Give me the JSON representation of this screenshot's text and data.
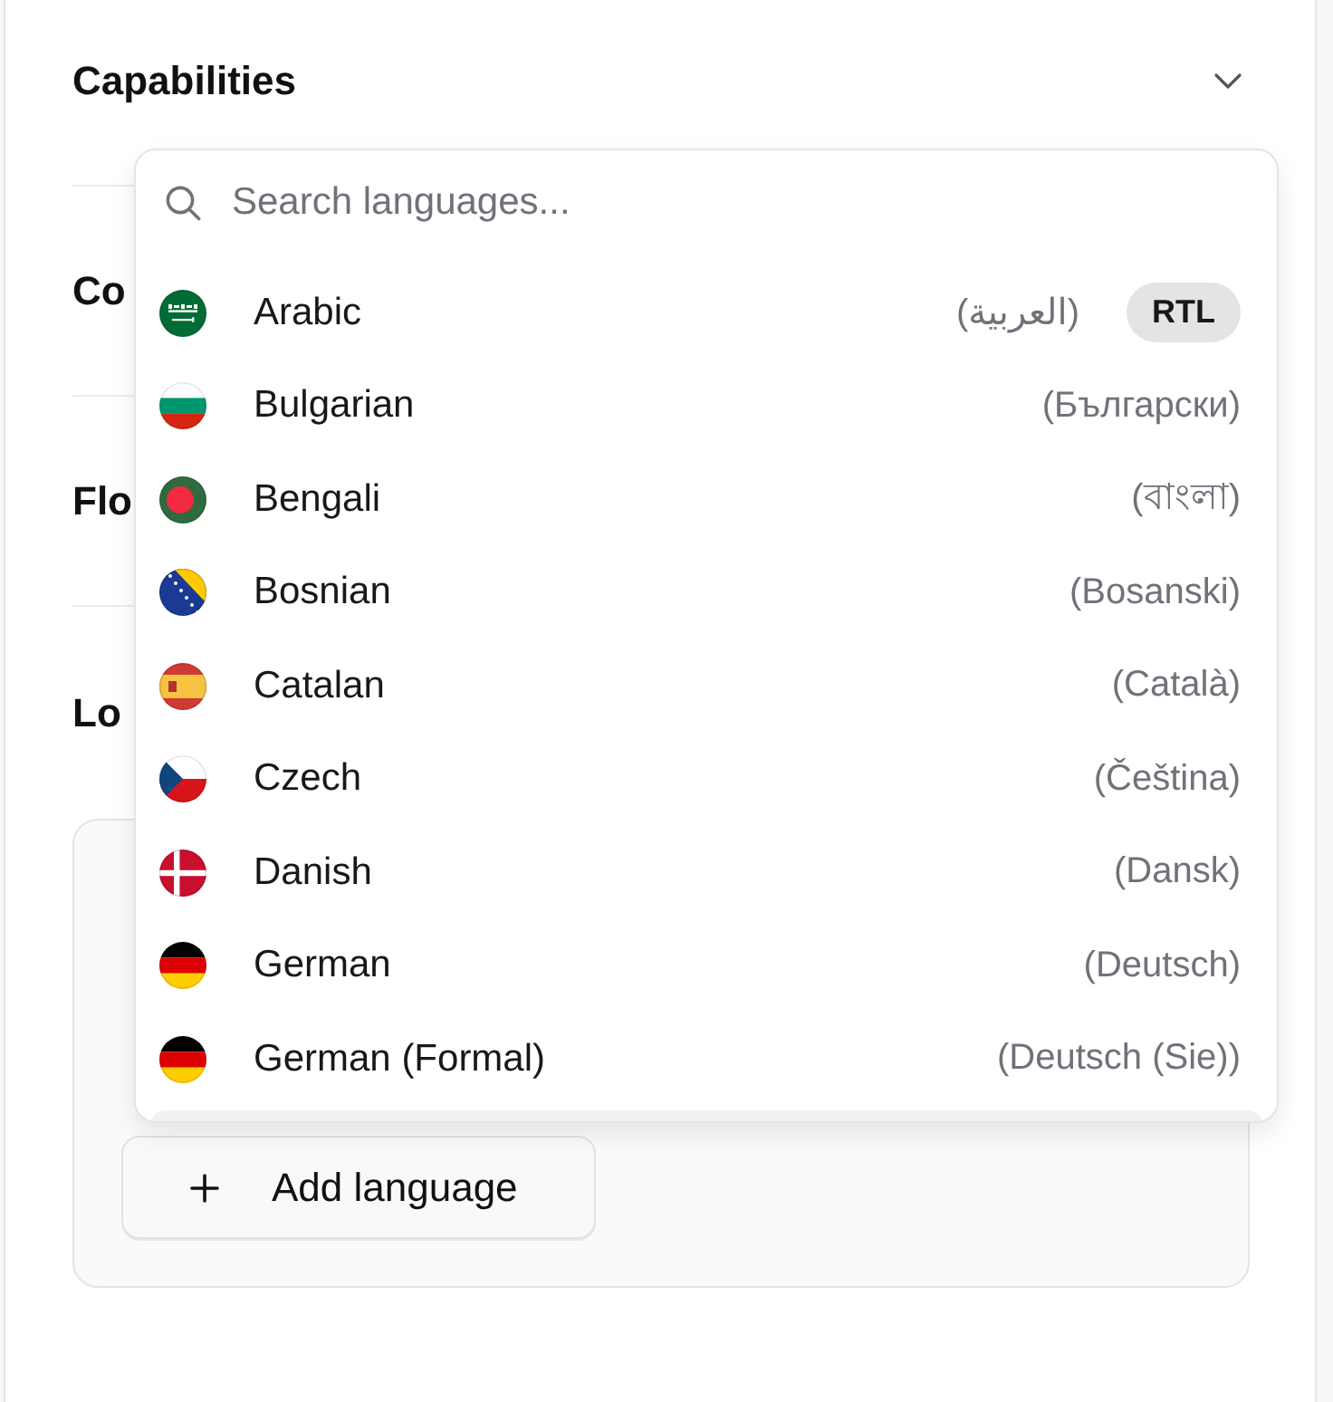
{
  "sections": [
    {
      "title": "Capabilities",
      "expanded": false
    },
    {
      "title": "Co"
    },
    {
      "title": "Flo"
    },
    {
      "title": "Lo",
      "card": {
        "button": "Add language"
      }
    }
  ],
  "language_menu": {
    "search": {
      "placeholder": "Search languages..."
    },
    "items": [
      {
        "name": "Arabic",
        "native": "(العربية)",
        "kind": "sa",
        "badge": "RTL"
      },
      {
        "name": "Bulgarian",
        "native": "(Български)",
        "kind": "bg"
      },
      {
        "name": "Bengali",
        "native": "(বাংলা)",
        "kind": "bd"
      },
      {
        "name": "Bosnian",
        "native": "(Bosanski)",
        "kind": "ba"
      },
      {
        "name": "Catalan",
        "native": "(Català)",
        "kind": "es"
      },
      {
        "name": "Czech",
        "native": "(Čeština)",
        "kind": "cz"
      },
      {
        "name": "Danish",
        "native": "(Dansk)",
        "kind": "dk"
      },
      {
        "name": "German",
        "native": "(Deutsch)",
        "kind": "de"
      },
      {
        "name": "German (Formal)",
        "native": "(Deutsch (Sie))",
        "kind": "de"
      }
    ],
    "partial_row": {
      "highlighted": true
    }
  }
}
